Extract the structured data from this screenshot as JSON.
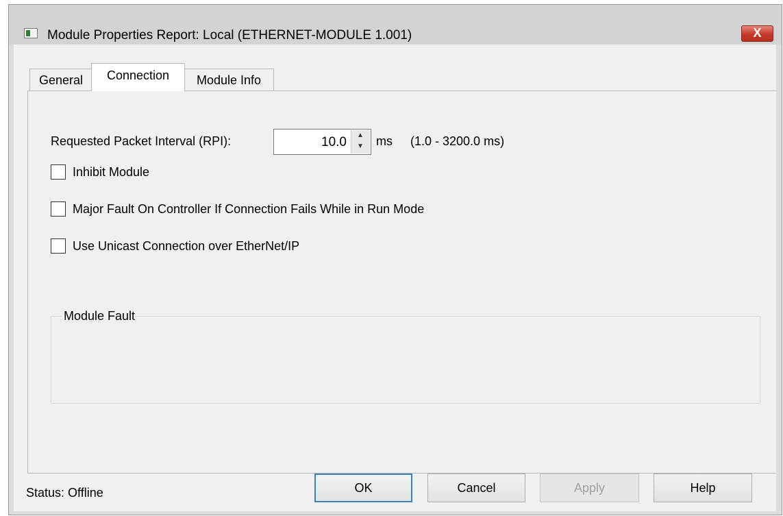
{
  "window": {
    "title": "Module Properties Report: Local (ETHERNET-MODULE 1.001)",
    "close_glyph": "X",
    "icon": "app-icon"
  },
  "tabs": [
    {
      "label": "General",
      "active": false
    },
    {
      "label": "Connection",
      "active": true
    },
    {
      "label": "Module Info",
      "active": false
    }
  ],
  "connection": {
    "rpi_label": "Requested Packet Interval (RPI):",
    "rpi_value": "10.0",
    "rpi_unit": "ms",
    "rpi_range": "(1.0 - 3200.0 ms)",
    "spin_up_glyph": "▲",
    "spin_down_glyph": "▼",
    "checkboxes": [
      {
        "label": "Inhibit Module",
        "checked": false
      },
      {
        "label": "Major Fault On Controller If Connection Fails While in Run Mode",
        "checked": false
      },
      {
        "label": "Use Unicast Connection over EtherNet/IP",
        "checked": false
      }
    ],
    "module_fault_title": "Module Fault",
    "module_fault_text": ""
  },
  "status": {
    "label": "Status:",
    "value": "Offline"
  },
  "buttons": {
    "ok": "OK",
    "cancel": "Cancel",
    "apply": "Apply",
    "help": "Help"
  },
  "colors": {
    "close_button": "#c43a2a",
    "default_button_border": "#3c7fb1",
    "client_background": "#f0f0f0"
  }
}
